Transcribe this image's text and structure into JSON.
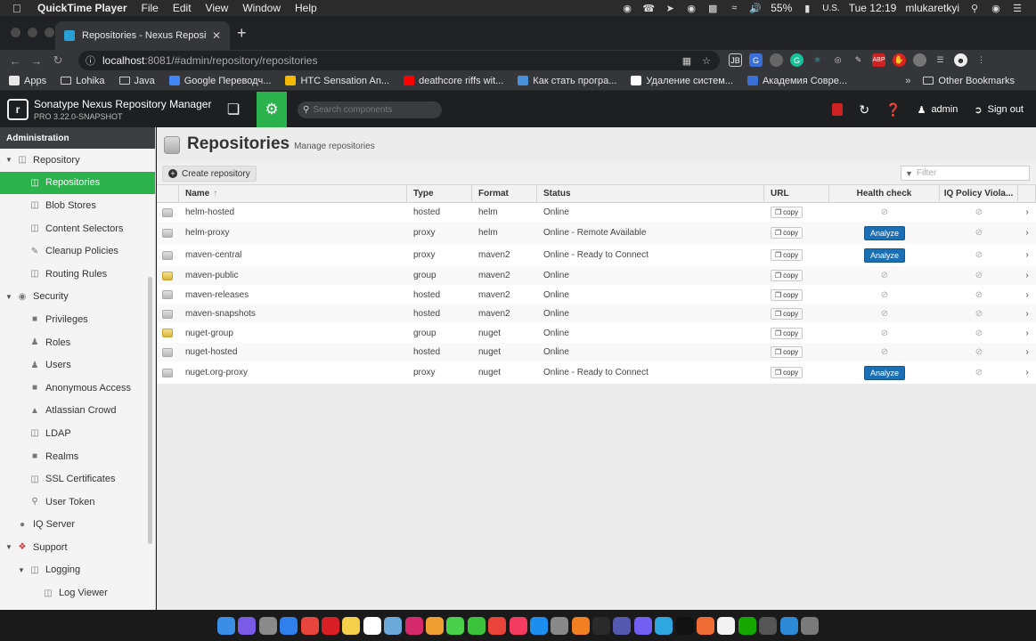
{
  "menubar": {
    "app_name": "QuickTime Player",
    "items": [
      "File",
      "Edit",
      "View",
      "Window",
      "Help"
    ],
    "battery": "55%",
    "input_source": "U.S.",
    "clock": "Tue 12:19",
    "user": "mlukaretkyi"
  },
  "browser": {
    "tab_title": "Repositories - Nexus Repositor",
    "url_host": "localhost",
    "url_rest": ":8081/#admin/repository/repositories",
    "bookmarks": [
      {
        "label": "Apps",
        "icon": "apps-grid-icon",
        "color": "#e8e8e8"
      },
      {
        "label": "Lohika",
        "icon": "folder-icon",
        "color": "#cccccc"
      },
      {
        "label": "Java",
        "icon": "folder-icon",
        "color": "#cccccc"
      },
      {
        "label": "Google Переводч...",
        "icon": "google-translate-icon",
        "color": "#4285f4"
      },
      {
        "label": "HTC Sensation An...",
        "icon": "htc-icon",
        "color": "#f5b800"
      },
      {
        "label": "deathcore riffs wit...",
        "icon": "youtube-icon",
        "color": "#ff0000"
      },
      {
        "label": "Как стать програ...",
        "icon": "article-icon",
        "color": "#4a90d9"
      },
      {
        "label": "Удаление систем...",
        "icon": "site-4-icon",
        "color": "#ffffff"
      },
      {
        "label": "Академия Совре...",
        "icon": "academy-icon",
        "color": "#3b6fd8"
      }
    ],
    "other_bookmarks": "Other Bookmarks"
  },
  "nexus": {
    "title": "Sonatype Nexus Repository Manager",
    "version": "PRO 3.22.0-SNAPSHOT",
    "search_placeholder": "Search components",
    "user": "admin",
    "sign_out": "Sign out",
    "accent": "#2bb24c"
  },
  "sidebar": {
    "header": "Administration",
    "items": [
      {
        "label": "Repository",
        "level": "lvl0",
        "expanded": true,
        "icon": "repository-icon"
      },
      {
        "label": "Repositories",
        "level": "lvl1",
        "active": true,
        "icon": "database-icon"
      },
      {
        "label": "Blob Stores",
        "level": "lvl1",
        "icon": "blob-store-icon"
      },
      {
        "label": "Content Selectors",
        "level": "lvl1",
        "icon": "content-selector-icon"
      },
      {
        "label": "Cleanup Policies",
        "level": "lvl1",
        "icon": "broom-icon"
      },
      {
        "label": "Routing Rules",
        "level": "lvl1",
        "icon": "routing-icon"
      },
      {
        "label": "Security",
        "level": "lvl0",
        "expanded": true,
        "icon": "security-eye-icon"
      },
      {
        "label": "Privileges",
        "level": "lvl1",
        "icon": "privileges-icon"
      },
      {
        "label": "Roles",
        "level": "lvl1",
        "icon": "roles-icon"
      },
      {
        "label": "Users",
        "level": "lvl1",
        "icon": "users-icon"
      },
      {
        "label": "Anonymous Access",
        "level": "lvl1",
        "icon": "anonymous-icon"
      },
      {
        "label": "Atlassian Crowd",
        "level": "lvl1",
        "icon": "crowd-icon"
      },
      {
        "label": "LDAP",
        "level": "lvl1",
        "icon": "ldap-icon"
      },
      {
        "label": "Realms",
        "level": "lvl1",
        "icon": "realms-icon"
      },
      {
        "label": "SSL Certificates",
        "level": "lvl1",
        "icon": "certificate-icon"
      },
      {
        "label": "User Token",
        "level": "lvl1",
        "icon": "token-icon"
      },
      {
        "label": "IQ Server",
        "level": "lvl0nc",
        "icon": "iq-server-icon"
      },
      {
        "label": "Support",
        "level": "lvl0",
        "expanded": true,
        "icon": "support-icon"
      },
      {
        "label": "Logging",
        "level": "lvl1c",
        "expanded": true,
        "icon": "logging-icon"
      },
      {
        "label": "Log Viewer",
        "level": "lvl2",
        "icon": "log-viewer-icon"
      }
    ]
  },
  "page": {
    "title": "Repositories",
    "subtitle": "Manage repositories",
    "create_button": "Create repository",
    "filter_placeholder": "Filter"
  },
  "table": {
    "columns": [
      "Name",
      "Type",
      "Format",
      "Status",
      "URL",
      "Health check",
      "IQ Policy Viola..."
    ],
    "copy_label": "copy",
    "analyze_label": "Analyze",
    "rows": [
      {
        "name": "helm-hosted",
        "type": "hosted",
        "format": "helm",
        "status": "Online",
        "analyze": false,
        "height": 21
      },
      {
        "name": "helm-proxy",
        "type": "proxy",
        "format": "helm",
        "status": "Online - Remote Available",
        "analyze": true,
        "height": 25
      },
      {
        "name": "maven-central",
        "type": "proxy",
        "format": "maven2",
        "status": "Online - Ready to Connect",
        "analyze": true,
        "height": 25
      },
      {
        "name": "maven-public",
        "type": "group",
        "format": "maven2",
        "status": "Online",
        "analyze": false,
        "height": 21
      },
      {
        "name": "maven-releases",
        "type": "hosted",
        "format": "maven2",
        "status": "Online",
        "analyze": false,
        "height": 22
      },
      {
        "name": "maven-snapshots",
        "type": "hosted",
        "format": "maven2",
        "status": "Online",
        "analyze": false,
        "height": 21
      },
      {
        "name": "nuget-group",
        "type": "group",
        "format": "nuget",
        "status": "Online",
        "analyze": false,
        "height": 22
      },
      {
        "name": "nuget-hosted",
        "type": "hosted",
        "format": "nuget",
        "status": "Online",
        "analyze": false,
        "height": 21
      },
      {
        "name": "nuget.org-proxy",
        "type": "proxy",
        "format": "nuget",
        "status": "Online - Ready to Connect",
        "analyze": true,
        "height": 25
      }
    ]
  },
  "dock": {
    "apps": [
      {
        "name": "finder-icon",
        "color": "#3a8ee6"
      },
      {
        "name": "siri-icon",
        "color": "#7a5be8"
      },
      {
        "name": "launchpad-icon",
        "color": "#8a8a8a"
      },
      {
        "name": "safari-icon",
        "color": "#2f80ed"
      },
      {
        "name": "chrome-icon",
        "color": "#e8453c"
      },
      {
        "name": "opera-icon",
        "color": "#d81f26"
      },
      {
        "name": "notes-icon",
        "color": "#f5d04a"
      },
      {
        "name": "calendar-icon",
        "color": "#ffffff"
      },
      {
        "name": "preview-icon",
        "color": "#6aa9d8"
      },
      {
        "name": "intellij-icon",
        "color": "#d42a6b"
      },
      {
        "name": "photos-icon",
        "color": "#f0a030"
      },
      {
        "name": "messages-icon",
        "color": "#4ad04a"
      },
      {
        "name": "facetime-icon",
        "color": "#3bc43b"
      },
      {
        "name": "news-icon",
        "color": "#e8443a"
      },
      {
        "name": "music-icon",
        "color": "#f43c60"
      },
      {
        "name": "appstore-icon",
        "color": "#1c8ef0"
      },
      {
        "name": "system-prefs-icon",
        "color": "#888888"
      },
      {
        "name": "sublime-icon",
        "color": "#f08020"
      },
      {
        "name": "activity-monitor-icon",
        "color": "#2a2a2a"
      },
      {
        "name": "teams-icon",
        "color": "#5558af"
      },
      {
        "name": "viber-icon",
        "color": "#7360f2"
      },
      {
        "name": "telegram-icon",
        "color": "#2ea6df"
      },
      {
        "name": "terminal-icon",
        "color": "#111111"
      },
      {
        "name": "postman-icon",
        "color": "#ef6c35"
      },
      {
        "name": "textedit-icon",
        "color": "#f2f2f2"
      },
      {
        "name": "upwork-icon",
        "color": "#14a800"
      },
      {
        "name": "screenshot-icon",
        "color": "#555555"
      },
      {
        "name": "edge-icon",
        "color": "#2c8ad6"
      },
      {
        "name": "trash-icon",
        "color": "#7a7a7a"
      }
    ]
  }
}
